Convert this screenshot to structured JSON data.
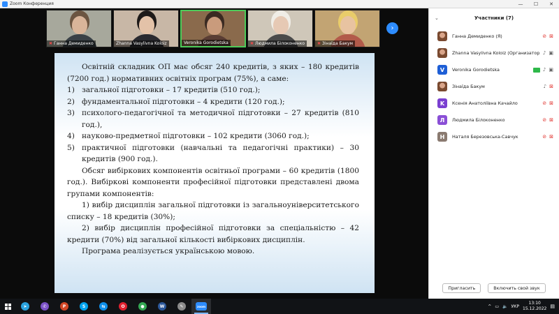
{
  "window": {
    "title": "Zoom Конференция"
  },
  "thumbnails": [
    {
      "name": "Ганна Демиденко",
      "muted": true,
      "bg": "#a7a89c",
      "skin": "#d9b59a",
      "hair": "#6b5541",
      "cloth": "#394046"
    },
    {
      "name": "Zhanna Vasylivna Koloiz",
      "muted": false,
      "bg": "#c8b7a6",
      "skin": "#e3c2a8",
      "hair": "#1e1a19",
      "cloth": "#2a2a30"
    },
    {
      "name": "Veronika Gorodietska",
      "muted": false,
      "bg": "#8a6a4c",
      "skin": "#c99b7c",
      "hair": "#3a2a22",
      "cloth": "#5a3d34"
    },
    {
      "name": "Людмила Білоконенко",
      "muted": true,
      "bg": "#cfc7b9",
      "skin": "#e6c9b4",
      "hair": "#f0ede6",
      "cloth": "#4a4a4a"
    },
    {
      "name": "Зінаїда Бакум",
      "muted": true,
      "bg": "#c2a473",
      "skin": "#e8c3a1",
      "hair": "#e9cc6a",
      "cloth": "#b25a4a"
    }
  ],
  "slide": {
    "intro": "Освітній складник ОП має обсяг 240 кредитів, з яких – 180 кредитів (7200 год.) нормативних освітніх програм (75%), а саме:",
    "items": [
      {
        "n": "1)",
        "text": "загальної підготовки – 17 кредитів (510 год.);"
      },
      {
        "n": "2)",
        "text": "фундаментальної підготовки – 4 кредити (120 год.);"
      },
      {
        "n": "3)",
        "text": "психолого-педагогічної та методичної підготовки – 27 кредитів (810 год.),"
      },
      {
        "n": "4)",
        "text": "науково-предметної підготовки – 102 кредити (3060 год.);"
      },
      {
        "n": "5)",
        "text": "практичної підготовки (навчальні та педагогічні практики) – 30 кредитів (900 год.)."
      }
    ],
    "elective": "Обсяг вибіркових компонентів освітньої програми – 60 кредитів (1800 год.). Вибіркові компоненти професійної підготовки представлені двома групами компонентів:",
    "choice1": "1) вибір дисциплін загальної підготовки із загальноуніверситетського списку – 18 кредитів (30%);",
    "choice2": "2) вибір дисциплін професійної підготовки за спеціальністю – 42 кредити (70%) від загальної кількості вибіркових дисциплін.",
    "language": "Програма реалізується українською мовою."
  },
  "panel": {
    "title": "Участники (7)",
    "participants": [
      {
        "name": "Ганна Демиденко (Я)",
        "initial": "",
        "avatar_color": "",
        "photo": true,
        "mic": "off",
        "video": "off",
        "sharing": false
      },
      {
        "name": "Zhanna Vasylivna Koloiz (Организатор)",
        "initial": "",
        "avatar_color": "",
        "photo": true,
        "mic": "on",
        "video": "on",
        "sharing": false
      },
      {
        "name": "Veronika Gorodietska",
        "initial": "V",
        "avatar_color": "#1e5fd6",
        "photo": false,
        "mic": "on",
        "video": "on",
        "sharing": true
      },
      {
        "name": "Зінаїда Бакум",
        "initial": "",
        "avatar_color": "",
        "photo": true,
        "mic": "on",
        "video": "off",
        "sharing": false
      },
      {
        "name": "Ксенія Анатоліївна Качайло",
        "initial": "K",
        "avatar_color": "#7a3fd1",
        "photo": false,
        "mic": "off",
        "video": "off",
        "sharing": false
      },
      {
        "name": "Людмила Білоконенко",
        "initial": "Л",
        "avatar_color": "#8a4fd6",
        "photo": false,
        "mic": "off",
        "video": "off",
        "sharing": false
      },
      {
        "name": "Наталя Березовська-Савчук",
        "initial": "Н",
        "avatar_color": "#8a7a70",
        "photo": false,
        "mic": "off",
        "video": "off",
        "sharing": false
      }
    ],
    "invite_label": "Пригласить",
    "unmute_label": "Включить свой звук"
  },
  "taskbar": {
    "apps": [
      {
        "name": "telegram-icon",
        "color": "#2aa3df",
        "glyph": "➤",
        "active": false
      },
      {
        "name": "viber-icon",
        "color": "#7b52c8",
        "glyph": "✆",
        "active": false
      },
      {
        "name": "powerpoint-icon",
        "color": "#d24726",
        "glyph": "P",
        "active": false
      },
      {
        "name": "skype-icon",
        "color": "#00a2ed",
        "glyph": "S",
        "active": false
      },
      {
        "name": "teamviewer-icon",
        "color": "#0e8ee9",
        "glyph": "⇆",
        "active": false
      },
      {
        "name": "opera-icon",
        "color": "#e0202e",
        "glyph": "O",
        "active": false
      },
      {
        "name": "chrome-icon",
        "color": "#34a853",
        "glyph": "●",
        "active": false
      },
      {
        "name": "word-icon",
        "color": "#2b579a",
        "glyph": "W",
        "active": false
      },
      {
        "name": "paint-icon",
        "color": "#8c8c8c",
        "glyph": "✎",
        "active": false
      },
      {
        "name": "zoom-icon",
        "color": "#2d8cff",
        "glyph": "zoom",
        "active": true
      }
    ],
    "language": "УКР",
    "time": "13:10",
    "date": "15.12.2022"
  },
  "colors": {
    "accent": "#2d8cff",
    "muted": "#e0342f",
    "active_border": "#4ecb5a"
  }
}
